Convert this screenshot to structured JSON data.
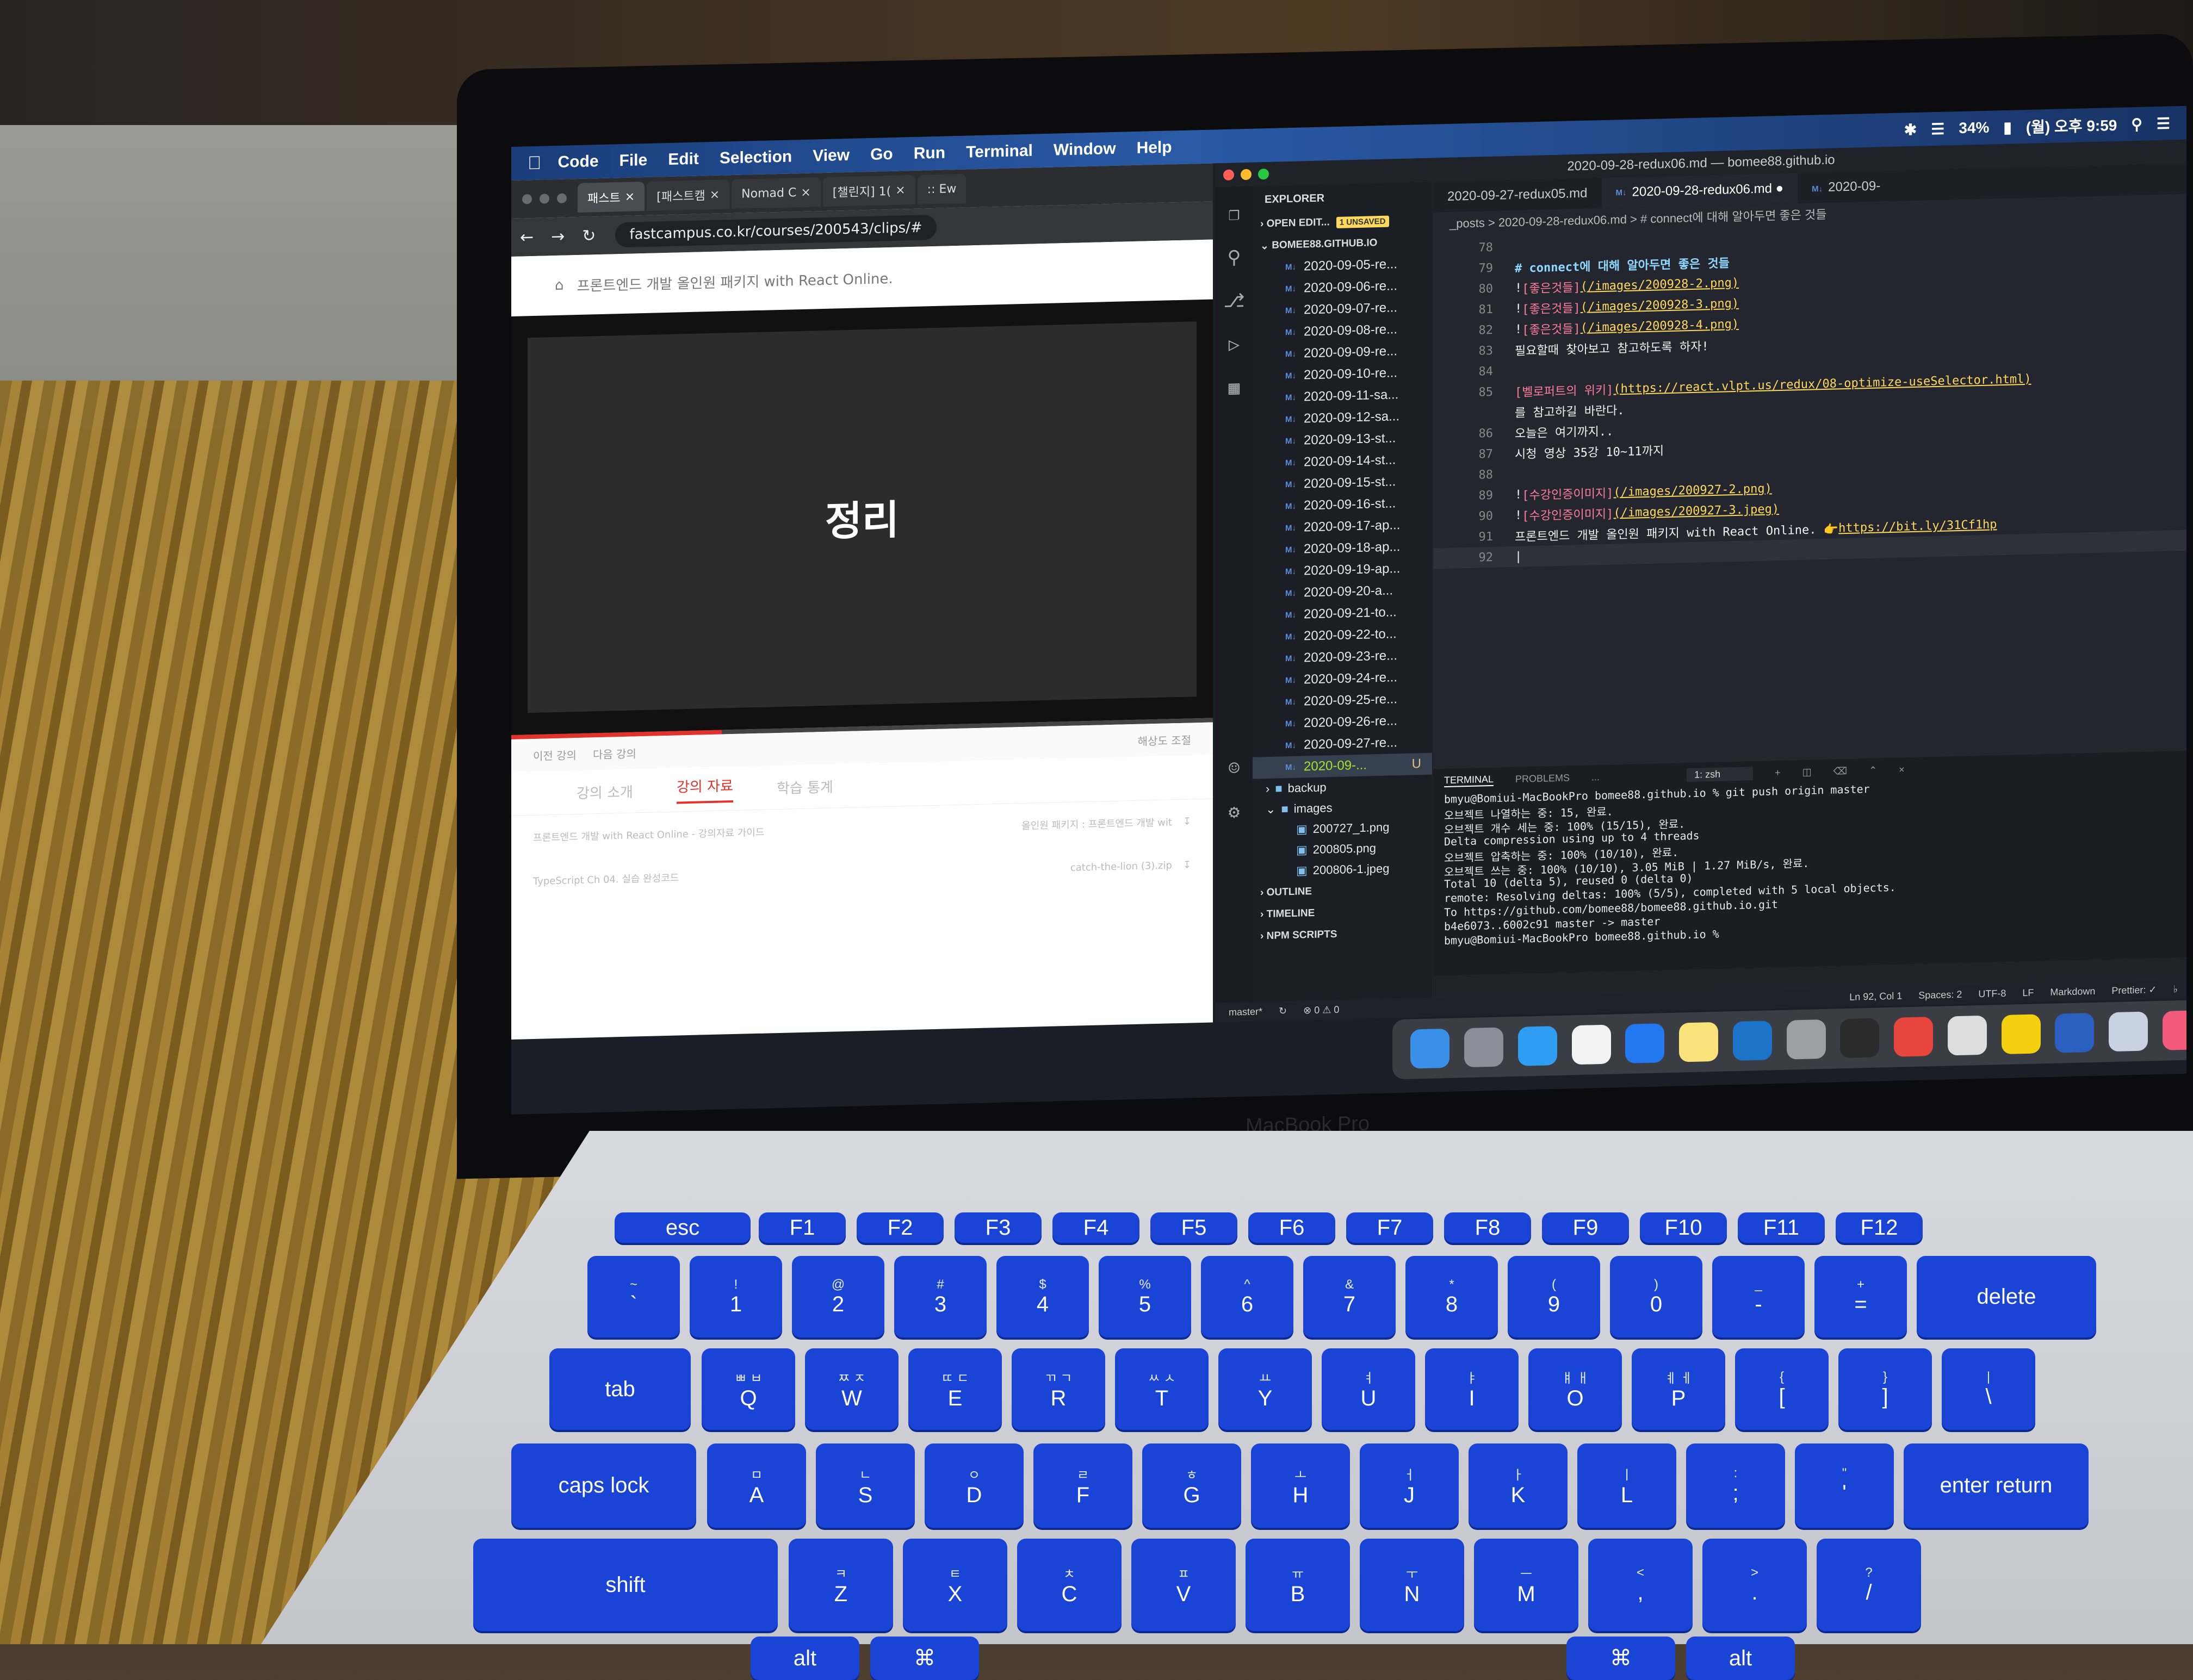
{
  "menubar": {
    "app": "Code",
    "items": [
      "File",
      "Edit",
      "Selection",
      "View",
      "Go",
      "Run",
      "Terminal",
      "Window",
      "Help"
    ],
    "battery": "34%",
    "clock": "(월) 오후 9:59"
  },
  "browser": {
    "tabs": [
      "패스트",
      "[패스트캠",
      "Nomad C",
      "[챌린지] 1(",
      ":: Ew"
    ],
    "url": "fastcampus.co.kr/courses/200543/clips/#",
    "course_title": "프론트엔드 개발 올인원 패키지 with React Online.",
    "slide_text": "정리",
    "prev_label": "이전 강의",
    "next_label": "다음 강의",
    "quality_label": "해상도 조절",
    "progress": 0.3,
    "lecture_tabs": [
      "강의 소개",
      "강의 자료",
      "학습 통계"
    ],
    "active_tab": "강의 자료",
    "files": [
      {
        "left": "프론트엔드 개발 with React Online - 강의자료 가이드",
        "right": "올인원 패키지 : 프론트엔드 개발 wit"
      },
      {
        "left": "TypeScript Ch 04. 실습 완성코드",
        "right": "catch-the-lion (3).zip"
      }
    ]
  },
  "vscode": {
    "window_title": "2020-09-28-redux06.md — bomee88.github.io",
    "explorer_label": "EXPLORER",
    "open_editors": "OPEN EDIT...",
    "unsaved": "1 UNSAVED",
    "project": "BOMEE88.GITHUB.IO",
    "files": [
      "2020-09-05-re...",
      "2020-09-06-re...",
      "2020-09-07-re...",
      "2020-09-08-re...",
      "2020-09-09-re...",
      "2020-09-10-re...",
      "2020-09-11-sa...",
      "2020-09-12-sa...",
      "2020-09-13-st...",
      "2020-09-14-st...",
      "2020-09-15-st...",
      "2020-09-16-st...",
      "2020-09-17-ap...",
      "2020-09-18-ap...",
      "2020-09-19-ap...",
      "2020-09-20-a...",
      "2020-09-21-to...",
      "2020-09-22-to...",
      "2020-09-23-re...",
      "2020-09-24-re...",
      "2020-09-25-re...",
      "2020-09-26-re...",
      "2020-09-27-re..."
    ],
    "selected_file": "2020-09-...",
    "selected_status": "U",
    "folders": [
      "backup",
      "images"
    ],
    "images": [
      "200727_1.png",
      "200805.png",
      "200806-1.jpeg"
    ],
    "sections": [
      "OUTLINE",
      "TIMELINE",
      "NPM SCRIPTS"
    ],
    "tabs": [
      "2020-09-27-redux05.md",
      "2020-09-28-redux06.md",
      "2020-09-"
    ],
    "breadcrumb": "_posts > 2020-09-28-redux06.md > # connect에 대해 알아두면 좋은 것들",
    "code": [
      {
        "n": "78",
        "parts": []
      },
      {
        "n": "79",
        "parts": [
          {
            "c": "c-h",
            "t": "# connect에 대해 알아두면 좋은 것들"
          }
        ]
      },
      {
        "n": "80",
        "parts": [
          {
            "c": "c-tx",
            "t": "!"
          },
          {
            "c": "c-lk",
            "t": "[좋은것들]"
          },
          {
            "c": "c-url",
            "t": "(/images/200928-2.png)"
          }
        ]
      },
      {
        "n": "81",
        "parts": [
          {
            "c": "c-tx",
            "t": "!"
          },
          {
            "c": "c-lk",
            "t": "[좋은것들]"
          },
          {
            "c": "c-url",
            "t": "(/images/200928-3.png)"
          }
        ]
      },
      {
        "n": "82",
        "parts": [
          {
            "c": "c-tx",
            "t": "!"
          },
          {
            "c": "c-lk",
            "t": "[좋은것들]"
          },
          {
            "c": "c-url",
            "t": "(/images/200928-4.png)"
          }
        ]
      },
      {
        "n": "83",
        "parts": [
          {
            "c": "c-tx",
            "t": "필요할때 찾아보고 참고하도록 하자!"
          }
        ]
      },
      {
        "n": "84",
        "parts": []
      },
      {
        "n": "85",
        "parts": [
          {
            "c": "c-lk",
            "t": "[벨로퍼트의 위키]"
          },
          {
            "c": "c-url",
            "t": "(https://react.vlpt.us/redux/08-optimize-useSelector.html)"
          }
        ]
      },
      {
        "n": "",
        "parts": [
          {
            "c": "c-tx",
            "t": "를 참고하길 바란다."
          }
        ]
      },
      {
        "n": "86",
        "parts": [
          {
            "c": "c-tx",
            "t": "오늘은 여기까지.."
          }
        ]
      },
      {
        "n": "87",
        "parts": [
          {
            "c": "c-tx",
            "t": "시청 영상 35강 10~11까지"
          }
        ]
      },
      {
        "n": "88",
        "parts": []
      },
      {
        "n": "89",
        "parts": [
          {
            "c": "c-tx",
            "t": "!"
          },
          {
            "c": "c-lk",
            "t": "[수강인증이미지]"
          },
          {
            "c": "c-url",
            "t": "(/images/200927-2.png)"
          }
        ]
      },
      {
        "n": "90",
        "parts": [
          {
            "c": "c-tx",
            "t": "!"
          },
          {
            "c": "c-lk",
            "t": "[수강인증이미지]"
          },
          {
            "c": "c-url",
            "t": "(/images/200927-3.jpeg)"
          }
        ]
      },
      {
        "n": "91",
        "parts": [
          {
            "c": "c-tx",
            "t": "프론트엔드 개발 올인원 패키지 with React Online. 👉 "
          },
          {
            "c": "c-url",
            "t": "https://bit.ly/31Cf1hp"
          }
        ]
      },
      {
        "n": "92",
        "parts": [
          {
            "c": "c-tx",
            "t": "|"
          }
        ]
      }
    ],
    "terminal": {
      "tabs": [
        "TERMINAL",
        "PROBLEMS",
        "..."
      ],
      "shell": "1: zsh",
      "lines": [
        "bmyu@Bomiui-MacBookPro bomee88.github.io % git push origin master",
        "오브젝트 나열하는 중: 15, 완료.",
        "오브젝트 개수 세는 중: 100% (15/15), 완료.",
        "Delta compression using up to 4 threads",
        "오브젝트 압축하는 중: 100% (10/10), 완료.",
        "오브젝트 쓰는 중: 100% (10/10), 3.05 MiB | 1.27 MiB/s, 완료.",
        "Total 10 (delta 5), reused 0 (delta 0)",
        "remote: Resolving deltas: 100% (5/5), completed with 5 local objects.",
        "To https://github.com/bomee88/bomee88.github.io.git",
        "   b4e6073..6002c91  master -> master",
        "bmyu@Bomiui-MacBookPro bomee88.github.io % "
      ]
    },
    "status": {
      "branch": "master*",
      "problems": "⊗ 0 ⚠ 0",
      "position": "Ln 92, Col 1",
      "spaces": "Spaces: 2",
      "encoding": "UTF-8",
      "eol": "LF",
      "language": "Markdown",
      "prettier": "Prettier: ✓"
    }
  },
  "laptop": {
    "label": "MacBook Pro"
  },
  "keyboard": {
    "fn_row": [
      "esc",
      "F1",
      "F2",
      "F3",
      "F4",
      "F5",
      "F6",
      "F7",
      "F8",
      "F9",
      "F10",
      "F11",
      "F12"
    ],
    "num_row": [
      {
        "top": "~",
        "bot": "`"
      },
      {
        "top": "!",
        "bot": "1"
      },
      {
        "top": "@",
        "bot": "2"
      },
      {
        "top": "#",
        "bot": "3"
      },
      {
        "top": "$",
        "bot": "4"
      },
      {
        "top": "%",
        "bot": "5"
      },
      {
        "top": "^",
        "bot": "6"
      },
      {
        "top": "&",
        "bot": "7"
      },
      {
        "top": "*",
        "bot": "8"
      },
      {
        "top": "(",
        "bot": "9"
      },
      {
        "top": ")",
        "bot": "0"
      },
      {
        "top": "_",
        "bot": "-"
      },
      {
        "top": "+",
        "bot": "="
      }
    ],
    "delete": "delete",
    "tab": "tab",
    "q_row": [
      {
        "top": "ㅃ ㅂ",
        "bot": "Q"
      },
      {
        "top": "ㅉ ㅈ",
        "bot": "W"
      },
      {
        "top": "ㄸ ㄷ",
        "bot": "E"
      },
      {
        "top": "ㄲ ㄱ",
        "bot": "R"
      },
      {
        "top": "ㅆ ㅅ",
        "bot": "T"
      },
      {
        "top": "ㅛ",
        "bot": "Y"
      },
      {
        "top": "ㅕ",
        "bot": "U"
      },
      {
        "top": "ㅑ",
        "bot": "I"
      },
      {
        "top": "ㅒ ㅐ",
        "bot": "O"
      },
      {
        "top": "ㅖ ㅔ",
        "bot": "P"
      },
      {
        "top": "{",
        "bot": "["
      },
      {
        "top": "}",
        "bot": "]"
      },
      {
        "top": "|",
        "bot": "\\"
      }
    ],
    "caps": "caps lock",
    "a_row": [
      {
        "top": "ㅁ",
        "bot": "A"
      },
      {
        "top": "ㄴ",
        "bot": "S"
      },
      {
        "top": "ㅇ",
        "bot": "D"
      },
      {
        "top": "ㄹ",
        "bot": "F"
      },
      {
        "top": "ㅎ",
        "bot": "G"
      },
      {
        "top": "ㅗ",
        "bot": "H"
      },
      {
        "top": "ㅓ",
        "bot": "J"
      },
      {
        "top": "ㅏ",
        "bot": "K"
      },
      {
        "top": "ㅣ",
        "bot": "L"
      },
      {
        "top": ":",
        "bot": ";"
      },
      {
        "top": "\"",
        "bot": "'"
      }
    ],
    "enter": "enter return",
    "shift": "shift",
    "z_row": [
      {
        "top": "ㅋ",
        "bot": "Z"
      },
      {
        "top": "ㅌ",
        "bot": "X"
      },
      {
        "top": "ㅊ",
        "bot": "C"
      },
      {
        "top": "ㅍ",
        "bot": "V"
      },
      {
        "top": "ㅠ",
        "bot": "B"
      },
      {
        "top": "ㅜ",
        "bot": "N"
      },
      {
        "top": "ㅡ",
        "bot": "M"
      },
      {
        "top": "<",
        "bot": ","
      },
      {
        "top": ">",
        "bot": "."
      },
      {
        "top": "?",
        "bot": "/"
      }
    ],
    "bottom": [
      "alt",
      "⌘",
      "⌘",
      "alt"
    ]
  }
}
